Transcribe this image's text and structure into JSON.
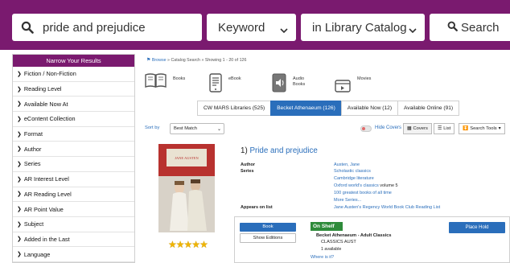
{
  "search": {
    "query": "pride and prejudice",
    "type_selected": "Keyword",
    "scope_selected": "in Library Catalog",
    "button_label": "Search"
  },
  "sidebar": {
    "header": "Narrow Your Results",
    "items": [
      {
        "label": "Fiction / Non-Fiction"
      },
      {
        "label": "Reading Level"
      },
      {
        "label": "Available Now At"
      },
      {
        "label": "eContent Collection"
      },
      {
        "label": "Format"
      },
      {
        "label": "Author"
      },
      {
        "label": "Series"
      },
      {
        "label": "AR Interest Level"
      },
      {
        "label": "AR Reading Level"
      },
      {
        "label": "AR Point Value"
      },
      {
        "label": "Subject"
      },
      {
        "label": "Added in the Last"
      },
      {
        "label": "Language"
      }
    ]
  },
  "breadcrumb": {
    "home": "Browse",
    "catalog": "Catalog Search",
    "showing": "Showing 1 - 20 of 126"
  },
  "formats": [
    {
      "label": "Books",
      "icon": "book-icon"
    },
    {
      "label": "eBook",
      "icon": "ebook-icon"
    },
    {
      "label": "Audio Books",
      "icon": "audio-icon"
    },
    {
      "label": "Movies",
      "icon": "movie-icon"
    }
  ],
  "tabs": [
    {
      "label": "CW MARS Libraries (525)",
      "active": false
    },
    {
      "label": "Becket Athenaeum (126)",
      "active": true
    },
    {
      "label": "Available Now (12)",
      "active": false
    },
    {
      "label": "Available Online (91)",
      "active": false
    }
  ],
  "sort": {
    "label": "Sort by",
    "selected": "Best Match",
    "hide_covers": "Hide Covers",
    "covers_btn": "Covers",
    "list_btn": "List",
    "tools_btn": "Search Tools"
  },
  "result": {
    "number": "1)",
    "title": "Pride and prejudice",
    "author_label": "Author",
    "author": "Austen, Jane",
    "series_label": "Series",
    "series": [
      "Scholastic classics",
      "Cambridge literature",
      "Oxford world's classics",
      "100 greatest books of all time",
      "More Series..."
    ],
    "series_volume": "volume 5",
    "appears_label": "Appears on list",
    "appears": "Jane Austen's Regency World Book Club Reading List",
    "rating_stars": 5,
    "cover_text": "JANE AUSTEN"
  },
  "holdings": {
    "format_btn": "Book",
    "editions_btn": "Show Editions",
    "status": "On Shelf",
    "location": "Becket Athenaeum - Adult Classics",
    "call_number": "CLASSICS AUST",
    "available": "1 available",
    "where": "Where is it?",
    "hold_btn": "Place Hold"
  },
  "colors": {
    "brand_purple": "#7a1a6f",
    "link_blue": "#2a6ebb",
    "shelf_green": "#2e8b3a",
    "star_gold": "#f0b400"
  }
}
